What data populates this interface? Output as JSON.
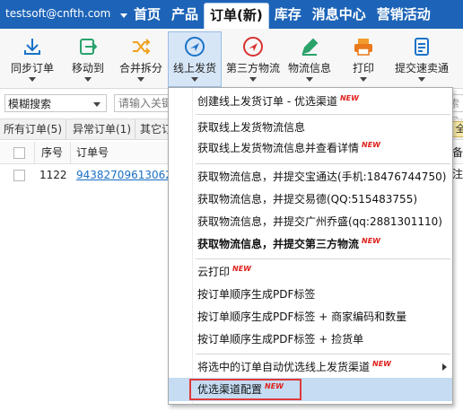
{
  "topbar": {
    "account": "testsoft@cnfth.com",
    "tabs": [
      {
        "label": "首页"
      },
      {
        "label": "产品"
      },
      {
        "label": "订单(新)"
      },
      {
        "label": "库存"
      },
      {
        "label": "消息中心"
      },
      {
        "label": "营销活动"
      }
    ],
    "active_tab": "订单(新)"
  },
  "toolbar": {
    "buttons": [
      {
        "label": "同步订单",
        "icon": "download-icon"
      },
      {
        "label": "移动到",
        "icon": "move-to-icon"
      },
      {
        "label": "合并拆分",
        "icon": "shuffle-icon"
      },
      {
        "label": "线上发货",
        "icon": "airplane-icon"
      },
      {
        "label": "第三方物流",
        "icon": "airplane-red-icon"
      },
      {
        "label": "物流信息",
        "icon": "pen-icon"
      },
      {
        "label": "打印",
        "icon": "printer-icon"
      },
      {
        "label": "提交速卖通",
        "icon": "clipboard-icon"
      }
    ],
    "active": "线上发货"
  },
  "filter": {
    "select_value": "模糊搜索",
    "search_placeholder": "请输入关键",
    "right_fragment": "索号"
  },
  "order_tabs": [
    {
      "label": "所有订单(5)"
    },
    {
      "label": "异常订单(1)"
    },
    {
      "label": "其它订"
    }
  ],
  "order_tabs_right": "全",
  "table": {
    "headers": {
      "seq": "序号",
      "order_no": "订单号",
      "right": "备注"
    },
    "rows": [
      {
        "seq": "1122",
        "order_no": "94382709613062"
      }
    ]
  },
  "menu": {
    "new_badge": "NEW",
    "items": [
      {
        "label": "创建线上发货订单 - 优选渠道",
        "new": true
      },
      {
        "label": "获取线上发货物流信息",
        "new": false
      },
      {
        "label": "获取线上发货物流信息并查看详情",
        "new": true
      },
      {
        "label": "获取物流信息，并提交宝通达(手机:18476744750)",
        "new": false
      },
      {
        "label": "获取物流信息，并提交易德(QQ:515483755)",
        "new": false
      },
      {
        "label": "获取物流信息，并提交广州乔盛(qq:2881301110)",
        "new": false
      },
      {
        "label": "获取物流信息，并提交第三方物流",
        "new": true,
        "bold": true
      },
      {
        "label": "云打印",
        "new": true
      },
      {
        "label": "按订单顺序生成PDF标签",
        "new": false
      },
      {
        "label": "按订单顺序生成PDF标签 + 商家编码和数量",
        "new": false
      },
      {
        "label": "按订单顺序生成PDF标签 + 捡货单",
        "new": false
      },
      {
        "label": "将选中的订单自动优选线上发货渠道",
        "new": true,
        "submenu": true
      },
      {
        "label": "优选渠道配置",
        "new": true,
        "highlight": true
      }
    ]
  },
  "colors": {
    "topbar": "#1d64b8",
    "active_tool_bg": "#d7e6f7",
    "new_badge": "#e0201b",
    "highlight": "#c5dcf2",
    "red_outline": "#e03a3a",
    "link": "#1a6fc4"
  }
}
